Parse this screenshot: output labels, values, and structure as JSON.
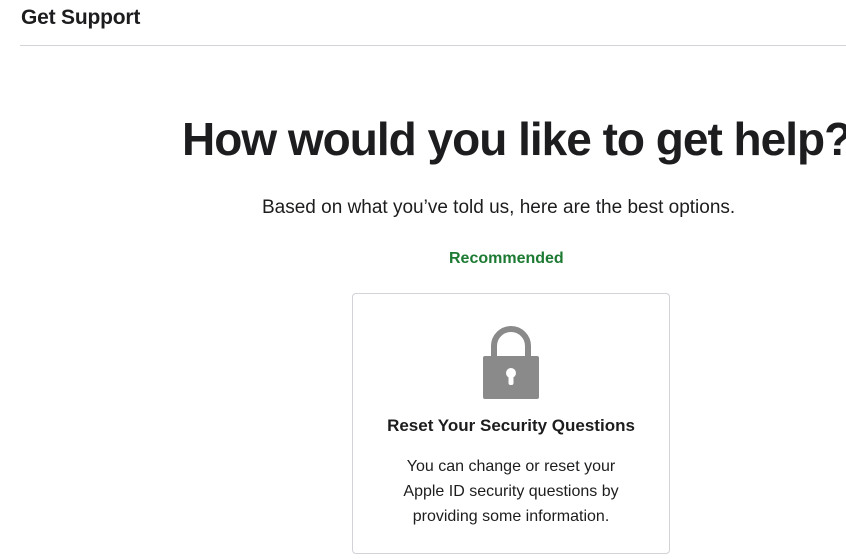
{
  "header": {
    "title": "Get Support"
  },
  "main": {
    "headline": "How would you like to get help?",
    "subhead": "Based on what you’ve told us, here are the best options.",
    "recommended_label": "Recommended",
    "card": {
      "icon": "lock-icon",
      "title": "Reset Your Security Questions",
      "description_lines": [
        "You can change or reset your",
        "Apple ID security questions by",
        "providing some information."
      ]
    }
  },
  "colors": {
    "recommended": "#1d7a33",
    "icon": "#8a8a8a",
    "divider": "#d2d2d7"
  }
}
